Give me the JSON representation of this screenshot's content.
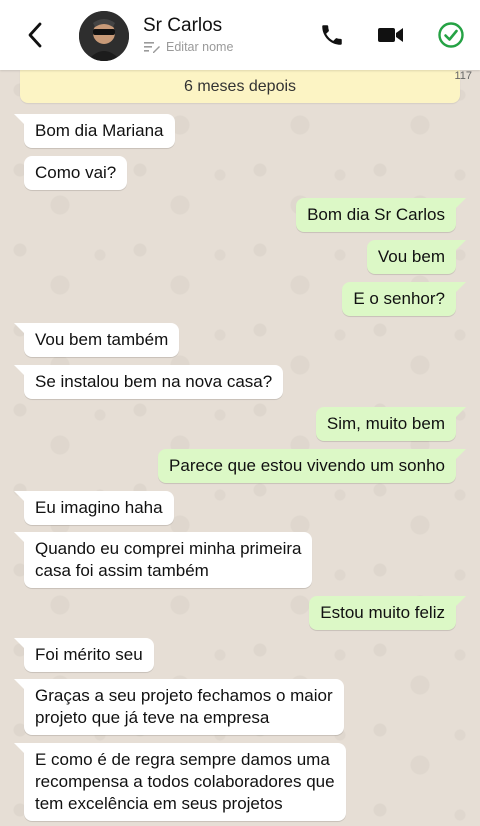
{
  "header": {
    "contact_name": "Sr Carlos",
    "edit_name_label": "Editar nome",
    "icons": {
      "back": "chevron-left-icon",
      "call": "phone-icon",
      "video": "video-camera-icon",
      "done": "check-circle-icon",
      "edit": "edit-lines-icon"
    }
  },
  "chat": {
    "date_banner": "6 meses depois",
    "counter": "117",
    "messages": [
      {
        "dir": "in",
        "text": "Bom dia Mariana"
      },
      {
        "dir": "in",
        "text": "Como vai?"
      },
      {
        "dir": "out",
        "text": "Bom dia Sr Carlos"
      },
      {
        "dir": "out",
        "text": "Vou bem"
      },
      {
        "dir": "out",
        "text": "E o senhor?"
      },
      {
        "dir": "in",
        "text": "Vou bem também"
      },
      {
        "dir": "in",
        "text": "Se instalou bem na nova casa?"
      },
      {
        "dir": "out",
        "text": "Sim, muito bem"
      },
      {
        "dir": "out",
        "text": "Parece que estou vivendo um sonho"
      },
      {
        "dir": "in",
        "text": "Eu imagino haha"
      },
      {
        "dir": "in",
        "text": "Quando eu comprei minha primeira\ncasa foi assim também"
      },
      {
        "dir": "out",
        "text": "Estou muito feliz"
      },
      {
        "dir": "in",
        "text": "Foi mérito seu"
      },
      {
        "dir": "in",
        "text": "Graças a seu projeto fechamos o maior\nprojeto que já teve na empresa"
      },
      {
        "dir": "in",
        "text": "E como é de regra sempre damos uma\nrecompensa a todos colaboradores que\ntem excelência em seus projetos"
      }
    ]
  },
  "colors": {
    "incoming_bubble": "#ffffff",
    "outgoing_bubble": "#dcf8c6",
    "date_banner": "#fcf4c4",
    "accent_green": "#25a244",
    "background": "#e6ded5"
  }
}
